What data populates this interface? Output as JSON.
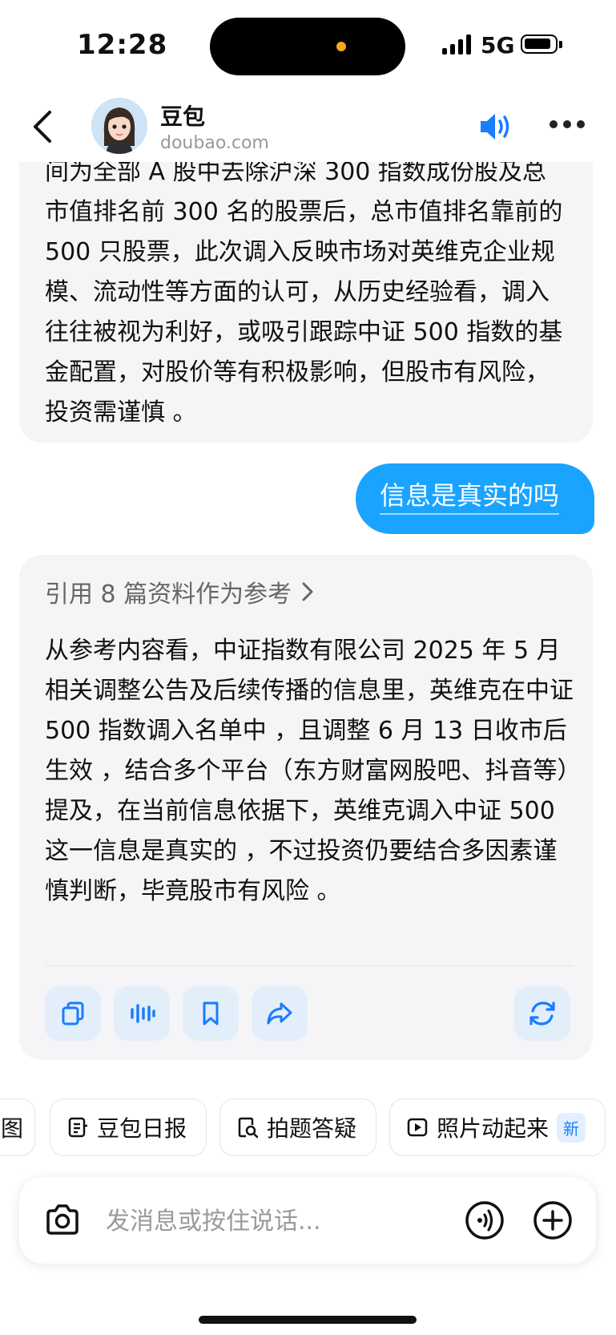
{
  "status_bar": {
    "time": "12:28",
    "network": "5G"
  },
  "header": {
    "bot_name": "豆包",
    "bot_domain": "doubao.com"
  },
  "conversation": {
    "previous_reply_tail": "间为全部 A 股中去除沪深 300 指数成份股及总市值排名前 300 名的股票后，总市值排名靠前的 500 只股票，此次调入反映市场对英维克企业规模、流动性等方面的认可，从历史经验看，调入往往被视为利好，或吸引跟踪中证 500 指数的基金配置，对股价等有积极影响，但股市有风险，投资需谨慎 。",
    "user_message": "信息是真实的吗",
    "references_label": "引用 8 篇资料作为参考",
    "bot_reply": "从参考内容看，中证指数有限公司 2025 年 5 月相关调整公告及后续传播的信息里，英维克在中证 500 指数调入名单中 ，且调整 6 月 13 日收市后生效 ，结合多个平台（东方财富网股吧、抖音等）提及，在当前信息依据下，英维克调入中证 500 这一信息是真实的 ，不过投资仍要结合多因素谨慎判断，毕竟股市有风险 。"
  },
  "quick_chips": [
    {
      "label": "图"
    },
    {
      "label": "豆包日报"
    },
    {
      "label": "拍题答疑"
    },
    {
      "label": "照片动起来",
      "badge": "新"
    }
  ],
  "input": {
    "placeholder": "发消息或按住说话..."
  },
  "colors": {
    "accent": "#1aa4ff",
    "bubble_bg": "#f5f5f7",
    "action_bg": "#e3eefb"
  }
}
